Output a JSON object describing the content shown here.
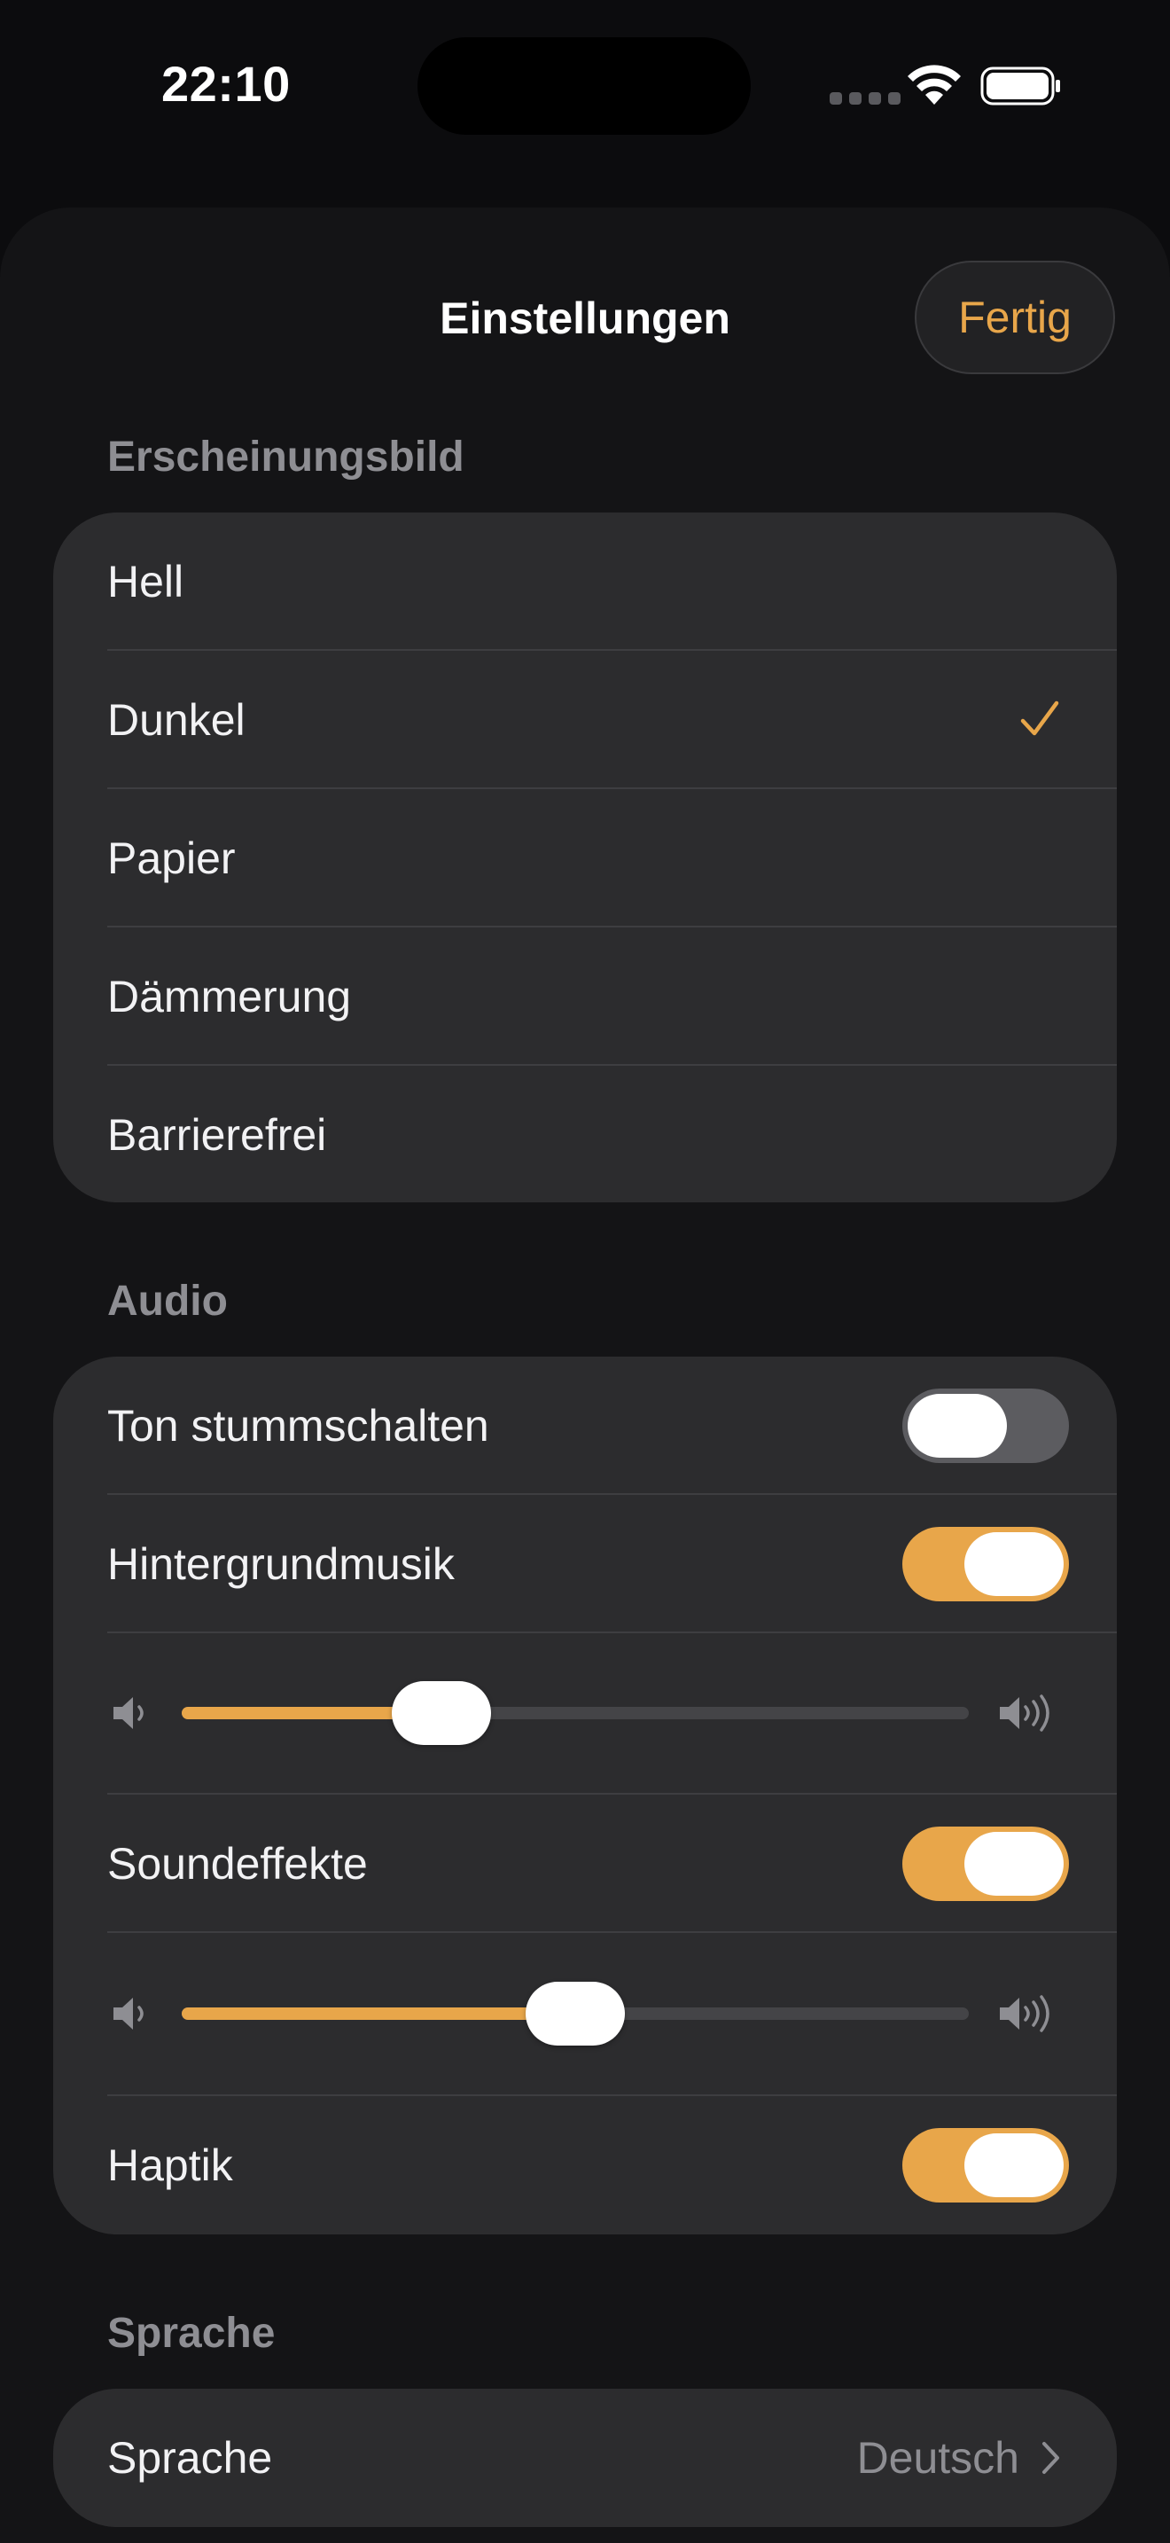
{
  "status_bar": {
    "time": "22:10"
  },
  "colors": {
    "accent": "#e8a64a",
    "background": "#0c0c0e",
    "group_background": "#2c2c2e",
    "secondary_text": "#8e8e93"
  },
  "header": {
    "title": "Einstellungen",
    "done_label": "Fertig"
  },
  "appearance": {
    "header": "Erscheinungsbild",
    "options": [
      {
        "label": "Hell",
        "selected": false
      },
      {
        "label": "Dunkel",
        "selected": true
      },
      {
        "label": "Papier",
        "selected": false
      },
      {
        "label": "Dämmerung",
        "selected": false
      },
      {
        "label": "Barrierefrei",
        "selected": false
      }
    ]
  },
  "audio": {
    "header": "Audio",
    "mute": {
      "label": "Ton stummschalten",
      "on": false
    },
    "music": {
      "label": "Hintergrundmusik",
      "on": true,
      "volume": 0.33
    },
    "effects": {
      "label": "Soundeffekte",
      "on": true,
      "volume": 0.5
    },
    "haptics": {
      "label": "Haptik",
      "on": true
    },
    "icons": {
      "volume_low": "speaker-low-icon",
      "volume_high": "speaker-high-icon"
    }
  },
  "language": {
    "header": "Sprache",
    "row_label": "Sprache",
    "value": "Deutsch"
  }
}
